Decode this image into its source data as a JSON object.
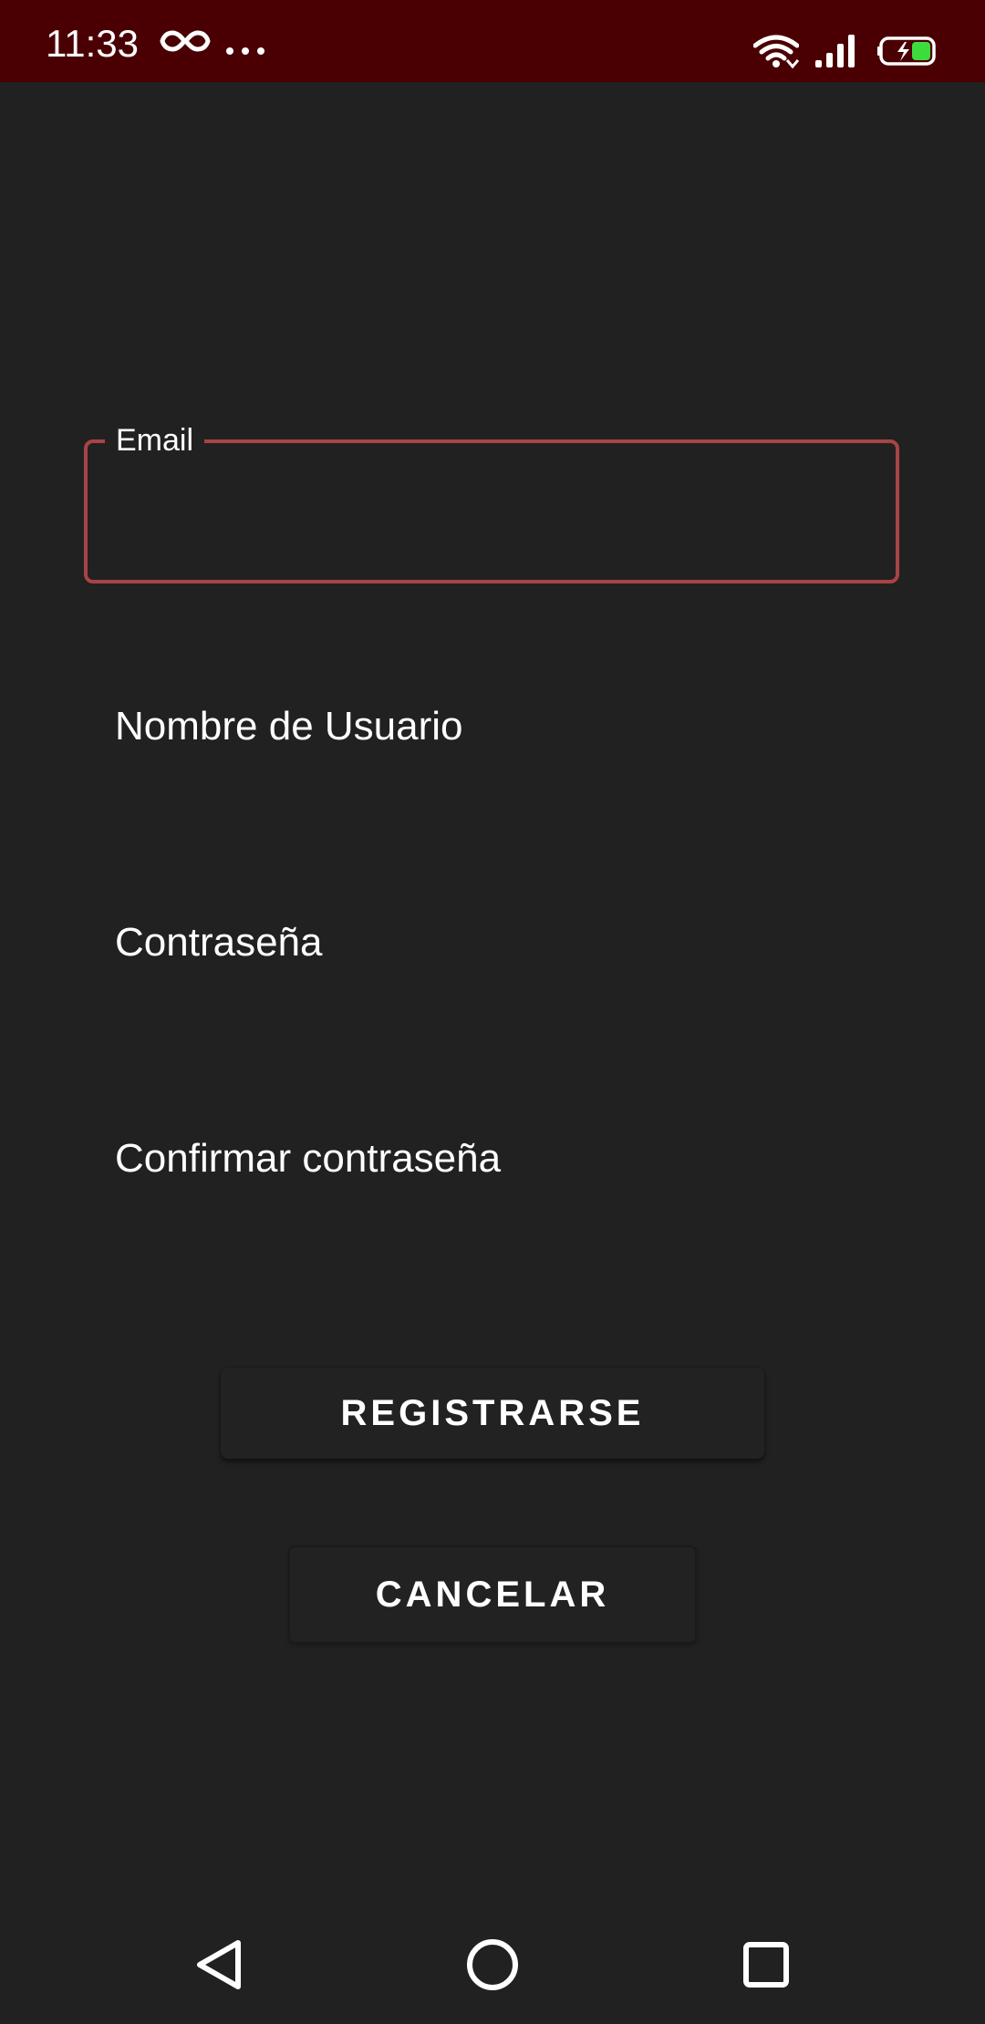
{
  "status_bar": {
    "time": "11:33",
    "background_color": "#4a0003",
    "icons": [
      "infinity-icon",
      "more-dots-icon",
      "wifi-icon",
      "signal-icon",
      "battery-charging-icon"
    ]
  },
  "form": {
    "email": {
      "label": "Email",
      "value": "",
      "border_color": "#a94345"
    },
    "username": {
      "label": "Nombre de Usuario"
    },
    "password": {
      "label": "Contraseña"
    },
    "confirm_password": {
      "label": "Confirmar contraseña"
    }
  },
  "buttons": {
    "register_label": "REGISTRARSE",
    "cancel_label": "CANCELAR"
  },
  "nav_bar": {
    "icons": [
      "back-icon",
      "home-icon",
      "recent-apps-icon"
    ]
  },
  "colors": {
    "background": "#212121",
    "accent": "#a94345",
    "text": "#ffffff"
  }
}
